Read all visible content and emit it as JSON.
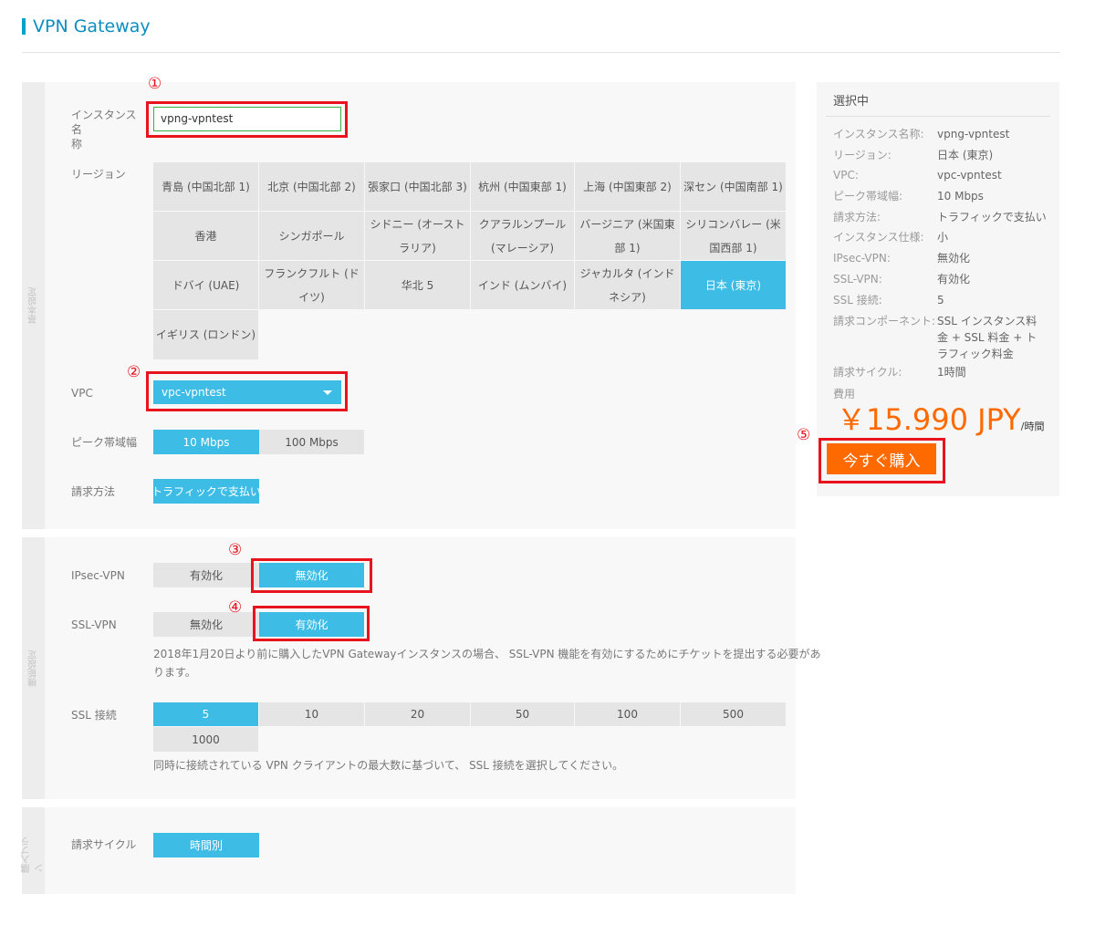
{
  "page": {
    "title": "VPN Gateway"
  },
  "markers": [
    "①",
    "②",
    "③",
    "④",
    "⑤"
  ],
  "sections": {
    "basic": "基本設定",
    "feature": "機能設定",
    "plan": "購入プラン"
  },
  "instance": {
    "label_line1": "インスタンス名",
    "label_line2": "称",
    "value": "vpng-vpntest"
  },
  "region": {
    "label": "リージョン",
    "rows": [
      [
        "青島 (中国北部 1)",
        "北京 (中国北部 2)",
        "張家口 (中国北部 3)",
        "杭州 (中国東部 1)",
        "上海 (中国東部 2)",
        "深セン (中国南部 1)"
      ],
      [
        "香港",
        "シンガポール",
        "シドニー (オーストラリア)",
        "クアラルンプール (マレーシア)",
        "バージニア (米国東部 1)",
        "シリコンバレー (米国西部 1)"
      ],
      [
        "ドバイ (UAE)",
        "フランクフルト (ドイツ)",
        "华北 5",
        "インド (ムンバイ)",
        "ジャカルタ (インドネシア)",
        "日本 (東京)"
      ],
      [
        "イギリス (ロンドン)"
      ]
    ],
    "selected": "日本 (東京)"
  },
  "vpc": {
    "label": "VPC",
    "value": "vpc-vpntest"
  },
  "bandwidth": {
    "label": "ピーク帯域幅",
    "options": [
      "10 Mbps",
      "100 Mbps"
    ],
    "selected": "10 Mbps"
  },
  "billing_method": {
    "label": "請求方法",
    "options": [
      "トラフィックで支払い"
    ],
    "selected": "トラフィックで支払い"
  },
  "ipsec": {
    "label": "IPsec-VPN",
    "options": [
      "有効化",
      "無効化"
    ],
    "selected": "無効化"
  },
  "ssl_vpn": {
    "label": "SSL-VPN",
    "options": [
      "無効化",
      "有効化"
    ],
    "selected": "有効化",
    "note_line1": "2018年1月20日より前に購入したVPN Gatewayインスタンスの場合、 SSL-VPN 機能を有効にするためにチケットを提出する必要があ",
    "note_line2": "ります。"
  },
  "ssl_connections": {
    "label": "SSL 接続",
    "options": [
      "5",
      "10",
      "20",
      "50",
      "100",
      "500",
      "1000"
    ],
    "selected": "5",
    "note": "同時に接続されている VPN クライアントの最大数に基づいて、 SSL 接続を選択してください。"
  },
  "billing_cycle": {
    "label": "請求サイクル",
    "options": [
      "時間別"
    ],
    "selected": "時間別"
  },
  "summary": {
    "heading": "選択中",
    "rows": [
      {
        "k": "インスタンス名称:",
        "v": [
          "vpng-vpntest"
        ]
      },
      {
        "k": "リージョン:",
        "v": [
          "日本 (東京)"
        ]
      },
      {
        "k": "VPC:",
        "v": [
          "vpc-vpntest"
        ]
      },
      {
        "k": "ピーク帯域幅:",
        "v": [
          "10 Mbps"
        ]
      },
      {
        "k": "請求方法:",
        "v": [
          "トラフィックで支払い"
        ]
      },
      {
        "k": "インスタンス仕様:",
        "v": [
          "小"
        ]
      },
      {
        "k": "IPsec-VPN:",
        "v": [
          "無効化"
        ]
      },
      {
        "k": "SSL-VPN:",
        "v": [
          "有効化"
        ]
      },
      {
        "k": "SSL 接続:",
        "v": [
          "5"
        ]
      },
      {
        "k": "請求コンポーネント:",
        "v": [
          "SSL インスタンス料",
          "金 + SSL 料金 + ト",
          "ラフィック料金"
        ]
      },
      {
        "k": "請求サイクル:",
        "v": [
          "1時間"
        ]
      }
    ],
    "fee_label": "費用",
    "price": "￥15.990 JPY",
    "price_unit": "/時間",
    "buy_label": "今すぐ購入"
  }
}
